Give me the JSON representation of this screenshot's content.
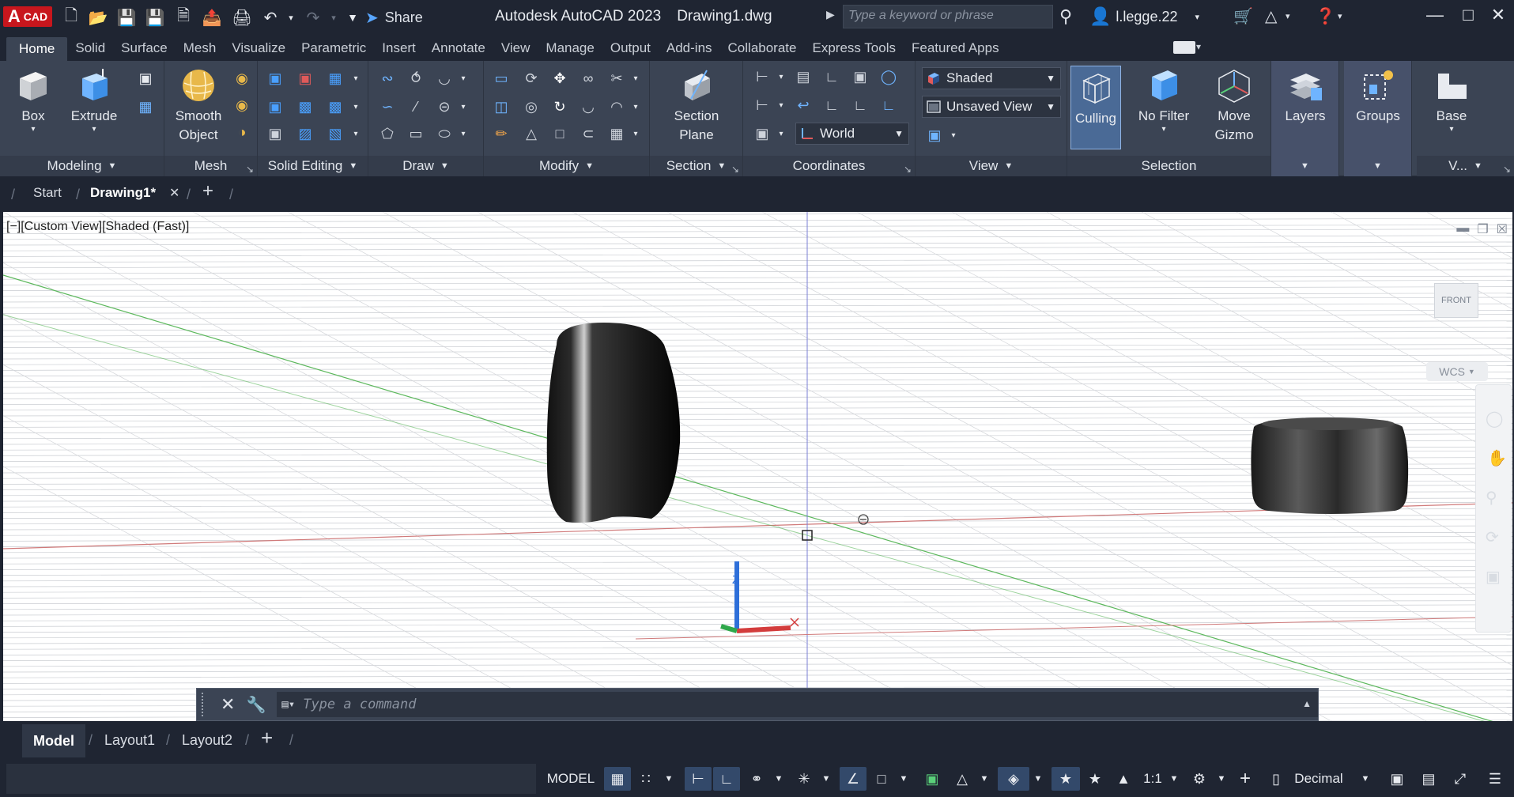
{
  "titlebar": {
    "logo_letter": "A",
    "logo_text": "CAD",
    "share_label": "Share",
    "app_title": "Autodesk AutoCAD 2023",
    "file_name": "Drawing1.dwg",
    "search_placeholder": "Type a keyword or phrase",
    "user_name": "l.legge.22"
  },
  "menu_tabs": [
    "Home",
    "Solid",
    "Surface",
    "Mesh",
    "Visualize",
    "Parametric",
    "Insert",
    "Annotate",
    "View",
    "Manage",
    "Output",
    "Add-ins",
    "Collaborate",
    "Express Tools",
    "Featured Apps"
  ],
  "ribbon": {
    "modeling": {
      "title": "Modeling",
      "box": "Box",
      "extrude": "Extrude"
    },
    "mesh": {
      "title": "Mesh",
      "smooth_object_1": "Smooth",
      "smooth_object_2": "Object"
    },
    "solid_editing": {
      "title": "Solid Editing"
    },
    "draw": {
      "title": "Draw"
    },
    "modify": {
      "title": "Modify"
    },
    "section": {
      "title": "Section",
      "plane_1": "Section",
      "plane_2": "Plane"
    },
    "coordinates": {
      "title": "Coordinates",
      "ucs_value": "World"
    },
    "view": {
      "title": "View",
      "visual_style": "Shaded",
      "named_view": "Unsaved View"
    },
    "selection": {
      "title": "Selection",
      "culling": "Culling",
      "no_filter": "No Filter",
      "move_gizmo_1": "Move",
      "move_gizmo_2": "Gizmo"
    },
    "layers": {
      "label": "Layers"
    },
    "groups": {
      "label": "Groups"
    },
    "base": {
      "label": "Base",
      "title": "V..."
    }
  },
  "file_tabs": {
    "start": "Start",
    "drawing": "Drawing1*"
  },
  "viewport": {
    "label": "[−][Custom View][Shaded (Fast)]",
    "viewcube_face": "FRONT",
    "wcs": "WCS",
    "axis_z": "Z"
  },
  "command": {
    "placeholder": "Type a command"
  },
  "layout_tabs": {
    "model": "Model",
    "layout1": "Layout1",
    "layout2": "Layout2"
  },
  "status": {
    "model": "MODEL",
    "scale": "1:1",
    "units": "Decimal"
  }
}
